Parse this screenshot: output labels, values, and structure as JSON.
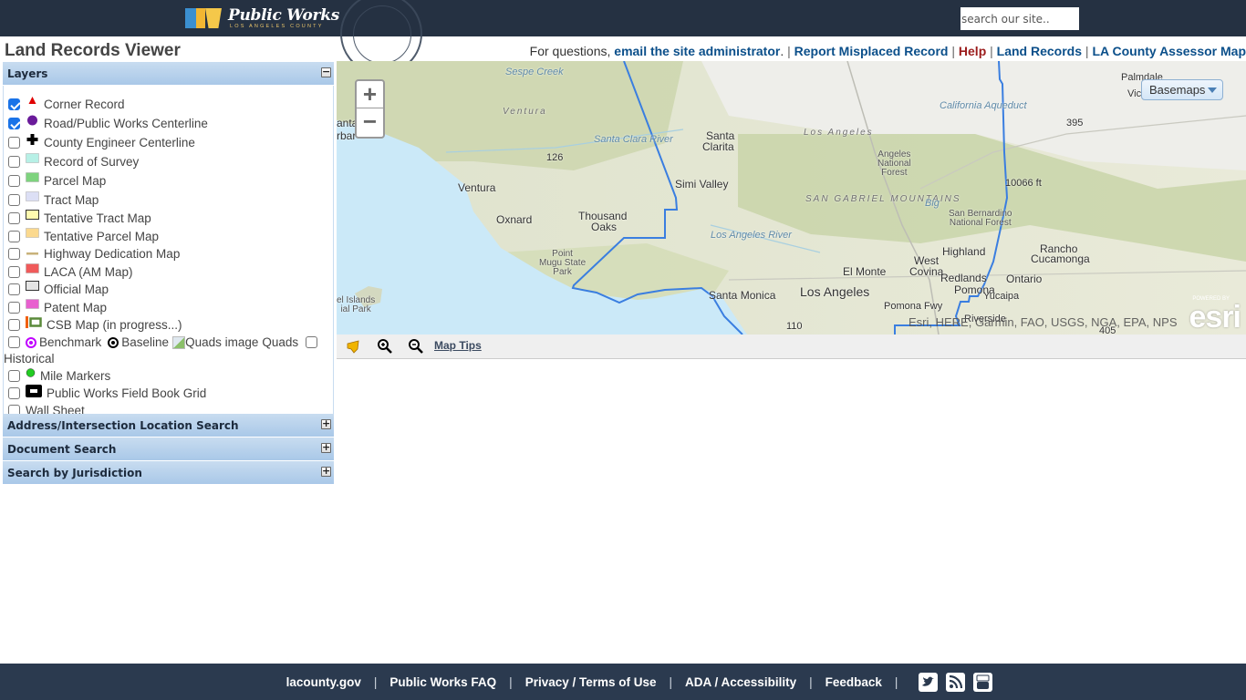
{
  "header": {
    "brand_title": "Public Works",
    "brand_subtitle": "LOS ANGELES COUNTY",
    "search_placeholder": "search our site.."
  },
  "page": {
    "title": "Land Records Viewer"
  },
  "top_links": {
    "prefix": "For questions, ",
    "email_admin": "email the site administrator",
    "email_suffix": ".",
    "report": "Report Misplaced Record",
    "help": "Help",
    "land_records": "Land Records",
    "assessor_map": "LA County Assessor Map",
    "separator": "|"
  },
  "panels": {
    "layers": {
      "title": "Layers",
      "toggle": "−"
    },
    "address_search": {
      "title": "Address/Intersection Location Search",
      "toggle": "+"
    },
    "document_search": {
      "title": "Document Search",
      "toggle": "+"
    },
    "jurisdiction_search": {
      "title": "Search by Jurisdiction",
      "toggle": "+"
    }
  },
  "layers": [
    {
      "label": "Corner Record",
      "checked": true,
      "symbol": "red-triangle",
      "color": "#e00000"
    },
    {
      "label": "Road/Public Works Centerline",
      "checked": true,
      "symbol": "purple-circle",
      "color": "#6a1b9a"
    },
    {
      "label": "County Engineer Centerline",
      "checked": false,
      "symbol": "black-cross",
      "color": "#000000"
    },
    {
      "label": "Record of Survey",
      "checked": false,
      "symbol": "swatch",
      "color": "#b7f0e6"
    },
    {
      "label": "Parcel Map",
      "checked": false,
      "symbol": "swatch",
      "color": "#7ed37e"
    },
    {
      "label": "Tract Map",
      "checked": false,
      "symbol": "swatch",
      "color": "#dcdff5"
    },
    {
      "label": "Tentative Tract Map",
      "checked": false,
      "symbol": "swatch-outlined",
      "color": "#fffbb0"
    },
    {
      "label": "Tentative Parcel Map",
      "checked": false,
      "symbol": "swatch",
      "color": "#fbd98e"
    },
    {
      "label": "Highway Dedication Map",
      "checked": false,
      "symbol": "line",
      "color": "#c8b27a"
    },
    {
      "label": "LACA (AM Map)",
      "checked": false,
      "symbol": "swatch",
      "color": "#f05a5a"
    },
    {
      "label": "Official Map",
      "checked": false,
      "symbol": "swatch-outlined",
      "color": "#e4e4e4"
    },
    {
      "label": "Patent Map",
      "checked": false,
      "symbol": "swatch",
      "color": "#e85fcf"
    },
    {
      "label": "CSB Map (in progress...)",
      "checked": false,
      "symbol": "csb",
      "color": "#5a8a3a"
    }
  ],
  "combined_row": {
    "benchmark": "Benchmark",
    "baseline": "Baseline",
    "quads_alt": "Quads image",
    "quads": "Quads",
    "historical": "Historical",
    "benchmark_color": "#c000ff"
  },
  "layers_after": [
    {
      "label": "Mile Markers",
      "checked": false,
      "symbol": "green-dot",
      "color": "#22cc22"
    },
    {
      "label": "Public Works Field Book Grid",
      "checked": false,
      "symbol": "black-rect",
      "color": "#000000"
    },
    {
      "label": "Wall Sheet",
      "checked": false,
      "symbol": "none",
      "color": ""
    }
  ],
  "map": {
    "zoom_in": "+",
    "zoom_out": "−",
    "basemaps_label": "Basemaps",
    "attribution": "Esri, HERE, Garmin, FAO, USGS, NGA, EPA, NPS",
    "esri_logo": "esri",
    "esri_powered": "POWERED BY",
    "boundary_color": "#3a7ee0",
    "places": {
      "palmdale": "Palmdale",
      "victorville": "Victor",
      "ventura_region": "Ventura",
      "ventura": "Ventura",
      "santa_clarita_1": "Santa",
      "santa_clarita_2": "Clarita",
      "simi_valley": "Simi Valley",
      "oxnard": "Oxnard",
      "thousand_oaks_1": "Thousand",
      "thousand_oaks_2": "Oaks",
      "point_mugu": "Point\nMugu State\nPark",
      "santa_monica": "Santa Monica",
      "los_angeles": "Los Angeles",
      "los_angeles_region": "Los Angeles",
      "el_monte": "El Monte",
      "west_covina_1": "West",
      "west_covina_2": "Covina",
      "pomona": "Pomona",
      "ontario": "Ontario",
      "rancho_1": "Rancho",
      "rancho_2": "Cucamonga",
      "highland": "Highland",
      "redlands": "Redlands",
      "yucaipa": "Yucaipa",
      "riverside": "Riverside",
      "angeles_nf": "Angeles\nNational\nForest",
      "san_bernardino_nf": "San Bernardino\nNational Forest",
      "san_gabriel": "SAN GABRIEL MOUNTAINS",
      "elevation": "10066 ft",
      "santa_clara_river": "Santa Clara River",
      "la_river": "Los Angeles River",
      "ca_aqueduct": "California Aqueduct",
      "sespe_creek": "Sespe Creek",
      "pomona_fwy": "Pomona Fwy",
      "channel_islands": "el Islands\nial Park",
      "santa_barbara": "anta\nrbar",
      "big_bear": "Big",
      "hwy_126": "126",
      "hwy_395": "395",
      "hwy_110": "110",
      "hwy_405": "405"
    }
  },
  "toolbar": {
    "identify_icon": "identify-icon",
    "zoom_in_icon": "magnifier-zoom-in-icon",
    "zoom_out_icon": "magnifier-zoom-out-icon",
    "map_tips": "Map Tips"
  },
  "footer": {
    "links": [
      "lacounty.gov",
      "Public Works FAQ",
      "Privacy / Terms of Use",
      "ADA / Accessibility",
      "Feedback"
    ],
    "separator": "|",
    "social": [
      "twitter",
      "rss",
      "youtube"
    ]
  }
}
